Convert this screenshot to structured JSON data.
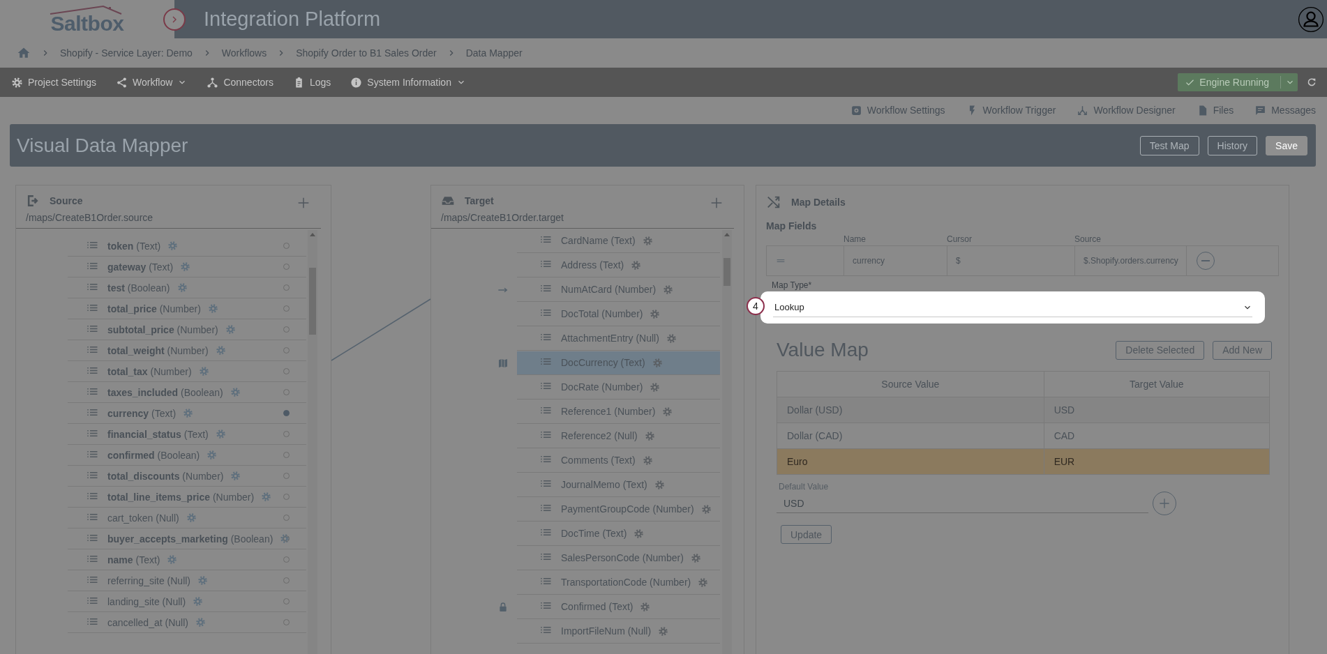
{
  "header": {
    "logo": "Saltbox",
    "title": "Integration Platform"
  },
  "breadcrumbs": [
    "Shopify - Service Layer: Demo",
    "Workflows",
    "Shopify Order to B1 Sales Order",
    "Data Mapper"
  ],
  "nav": [
    {
      "label": "Project Settings",
      "dropdown": false
    },
    {
      "label": "Workflow",
      "dropdown": true
    },
    {
      "label": "Connectors",
      "dropdown": false
    },
    {
      "label": "Logs",
      "dropdown": false
    },
    {
      "label": "System Information",
      "dropdown": true
    }
  ],
  "engine_status": {
    "label": "Engine Running"
  },
  "workflow_links": [
    "Workflow Settings",
    "Workflow Trigger",
    "Workflow Designer",
    "Files",
    "Messages"
  ],
  "page_title": "Visual Data Mapper",
  "page_actions": [
    {
      "label": "Test Map",
      "disabled": false
    },
    {
      "label": "History",
      "disabled": false
    },
    {
      "label": "Save",
      "disabled": true
    }
  ],
  "source": {
    "title": "Source",
    "path": "/maps/CreateB1Order.source",
    "fields": [
      {
        "name": "token",
        "type": "(Text)",
        "bold": true,
        "selected": false
      },
      {
        "name": "gateway",
        "type": "(Text)",
        "bold": true,
        "selected": false
      },
      {
        "name": "test",
        "type": "(Boolean)",
        "bold": true,
        "selected": false
      },
      {
        "name": "total_price",
        "type": "(Number)",
        "bold": true,
        "selected": false
      },
      {
        "name": "subtotal_price",
        "type": "(Number)",
        "bold": true,
        "selected": false
      },
      {
        "name": "total_weight",
        "type": "(Number)",
        "bold": true,
        "selected": false
      },
      {
        "name": "total_tax",
        "type": "(Number)",
        "bold": true,
        "selected": false
      },
      {
        "name": "taxes_included",
        "type": "(Boolean)",
        "bold": true,
        "selected": false
      },
      {
        "name": "currency",
        "type": "(Text)",
        "bold": true,
        "selected": true
      },
      {
        "name": "financial_status",
        "type": "(Text)",
        "bold": true,
        "selected": false
      },
      {
        "name": "confirmed",
        "type": "(Boolean)",
        "bold": true,
        "selected": false
      },
      {
        "name": "total_discounts",
        "type": "(Number)",
        "bold": true,
        "selected": false
      },
      {
        "name": "total_line_items_price",
        "type": "(Number)",
        "bold": true,
        "selected": false
      },
      {
        "name": "cart_token",
        "type": "(Null)",
        "bold": false,
        "selected": false
      },
      {
        "name": "buyer_accepts_marketing",
        "type": "(Boolean)",
        "bold": true,
        "selected": false
      },
      {
        "name": "name",
        "type": "(Text)",
        "bold": true,
        "selected": false
      },
      {
        "name": "referring_site",
        "type": "(Null)",
        "bold": false,
        "selected": false
      },
      {
        "name": "landing_site",
        "type": "(Null)",
        "bold": false,
        "selected": false
      },
      {
        "name": "cancelled_at",
        "type": "(Null)",
        "bold": false,
        "selected": false
      }
    ]
  },
  "target": {
    "title": "Target",
    "path": "/maps/CreateB1Order.target",
    "fields": [
      {
        "label": "CardName (Text)",
        "kind": "plain",
        "selected": false
      },
      {
        "label": "Address (Text)",
        "kind": "plain",
        "selected": false
      },
      {
        "label": "NumAtCard (Number)",
        "kind": "arrow",
        "selected": false
      },
      {
        "label": "DocTotal (Number)",
        "kind": "plain",
        "selected": false
      },
      {
        "label": "AttachmentEntry (Null)",
        "kind": "plain",
        "selected": false
      },
      {
        "label": "DocCurrency (Text)",
        "kind": "map",
        "selected": true
      },
      {
        "label": "DocRate (Number)",
        "kind": "plain",
        "selected": false
      },
      {
        "label": "Reference1 (Number)",
        "kind": "plain",
        "selected": false
      },
      {
        "label": "Reference2 (Null)",
        "kind": "plain",
        "selected": false
      },
      {
        "label": "Comments (Text)",
        "kind": "plain",
        "selected": false
      },
      {
        "label": "JournalMemo (Text)",
        "kind": "plain",
        "selected": false
      },
      {
        "label": "PaymentGroupCode (Number)",
        "kind": "plain",
        "selected": false
      },
      {
        "label": "DocTime (Text)",
        "kind": "plain",
        "selected": false
      },
      {
        "label": "SalesPersonCode (Number)",
        "kind": "plain",
        "selected": false
      },
      {
        "label": "TransportationCode (Number)",
        "kind": "plain",
        "selected": false
      },
      {
        "label": "Confirmed (Text)",
        "kind": "lock",
        "selected": false
      },
      {
        "label": "ImportFileNum (Null)",
        "kind": "plain",
        "selected": false
      }
    ]
  },
  "map_details": {
    "title": "Map Details",
    "map_fields": {
      "label": "Map Fields",
      "columns": [
        "Name",
        "Cursor",
        "Source"
      ],
      "row": {
        "name": "currency",
        "cursor": "$",
        "source": "$.Shopify.orders.currency"
      }
    },
    "map_type": {
      "label": "Map Type*",
      "value": "Lookup"
    },
    "tour_step": "4",
    "value_map": {
      "title": "Value Map",
      "actions": [
        "Delete Selected",
        "Add New"
      ],
      "columns": [
        "Source Value",
        "Target Value"
      ],
      "rows": [
        {
          "source": "Dollar (USD)",
          "target": "USD",
          "selected": false
        },
        {
          "source": "Dollar (CAD)",
          "target": "CAD",
          "selected": false
        },
        {
          "source": "Euro",
          "target": "EUR",
          "selected": true
        }
      ]
    },
    "default_value": {
      "label": "Default Value",
      "value": "USD"
    },
    "update_button": "Update"
  }
}
